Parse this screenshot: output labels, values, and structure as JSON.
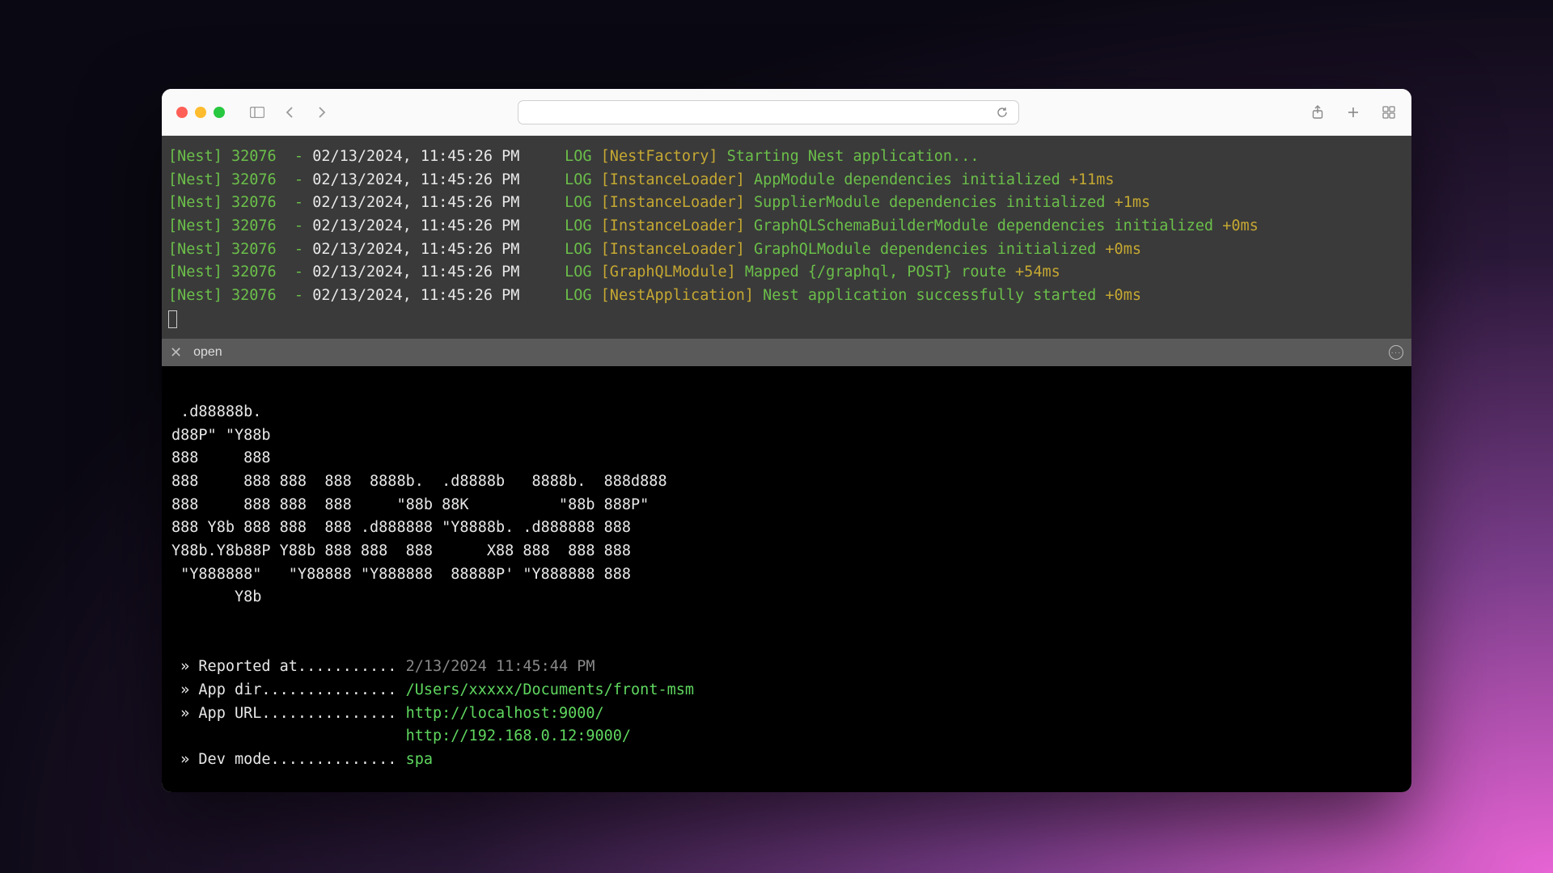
{
  "window": {
    "address": ""
  },
  "tab": {
    "label": "open"
  },
  "logs": [
    {
      "prefix": "[Nest] 32076  - ",
      "ts": "02/13/2024, 11:45:26 PM",
      "level": "LOG",
      "ctx": "[NestFactory]",
      "msg": "Starting Nest application...",
      "suffix": ""
    },
    {
      "prefix": "[Nest] 32076  - ",
      "ts": "02/13/2024, 11:45:26 PM",
      "level": "LOG",
      "ctx": "[InstanceLoader]",
      "msg": "AppModule dependencies initialized",
      "suffix": "+11ms"
    },
    {
      "prefix": "[Nest] 32076  - ",
      "ts": "02/13/2024, 11:45:26 PM",
      "level": "LOG",
      "ctx": "[InstanceLoader]",
      "msg": "SupplierModule dependencies initialized",
      "suffix": "+1ms"
    },
    {
      "prefix": "[Nest] 32076  - ",
      "ts": "02/13/2024, 11:45:26 PM",
      "level": "LOG",
      "ctx": "[InstanceLoader]",
      "msg": "GraphQLSchemaBuilderModule dependencies initialized",
      "suffix": "+0ms"
    },
    {
      "prefix": "[Nest] 32076  - ",
      "ts": "02/13/2024, 11:45:26 PM",
      "level": "LOG",
      "ctx": "[InstanceLoader]",
      "msg": "GraphQLModule dependencies initialized",
      "suffix": "+0ms"
    },
    {
      "prefix": "[Nest] 32076  - ",
      "ts": "02/13/2024, 11:45:26 PM",
      "level": "LOG",
      "ctx": "[GraphQLModule]",
      "msg": "Mapped {/graphql, POST} route",
      "suffix": "+54ms"
    },
    {
      "prefix": "[Nest] 32076  - ",
      "ts": "02/13/2024, 11:45:26 PM",
      "level": "LOG",
      "ctx": "[NestApplication]",
      "msg": "Nest application successfully started",
      "suffix": "+0ms"
    }
  ],
  "ascii": " .d88888b.\nd88P\" \"Y88b\n888     888\n888     888 888  888  8888b.  .d8888b   8888b.  888d888\n888     888 888  888     \"88b 88K          \"88b 888P\"\n888 Y8b 888 888  888 .d888888 \"Y8888b. .d888888 888\nY88b.Y8b88P Y88b 888 888  888      X88 888  888 888\n \"Y888888\"   \"Y88888 \"Y888888  88888P' \"Y888888 888\n       Y8b",
  "info": {
    "reported_label": " » Reported at........... ",
    "reported_value": "2/13/2024 11:45:44 PM",
    "appdir_label": " » App dir............... ",
    "appdir_value": "/Users/xxxxx/Documents/front-msm",
    "appurl_label": " » App URL............... ",
    "appurl_value1": "http://localhost:9000/",
    "appurl_value2": "http://192.168.0.12:9000/",
    "devmode_label": " » Dev mode.............. ",
    "devmode_value": "spa",
    "url2_pad": "                          "
  }
}
